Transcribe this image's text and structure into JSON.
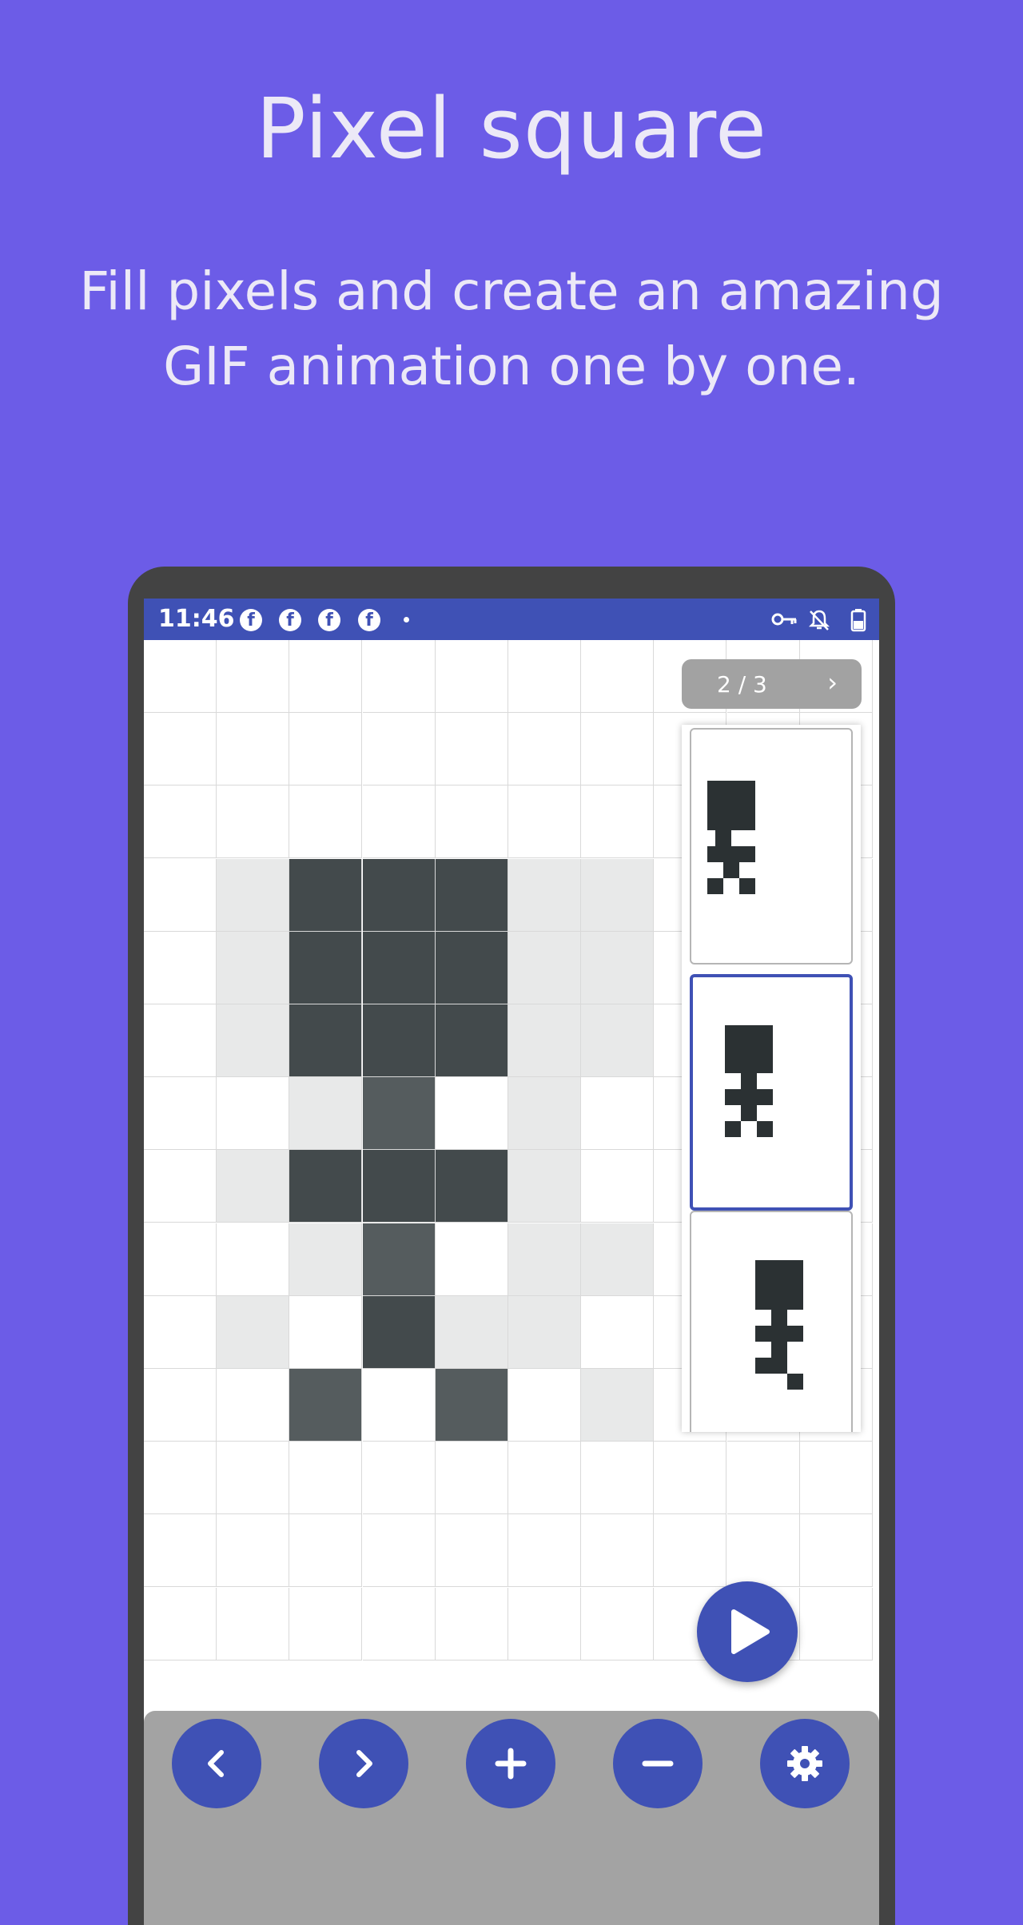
{
  "headline": "Pixel square",
  "subtitle": {
    "line1": "Fill pixels and create an amazing",
    "line2": "GIF animation one by one."
  },
  "status_bar": {
    "time": "11:46",
    "notification_icons": [
      "facebook-icon",
      "facebook-icon",
      "facebook-icon",
      "facebook-icon",
      "dot"
    ],
    "right_icons": [
      "vpn-key-icon",
      "notifications-off-icon",
      "battery-icon"
    ]
  },
  "frames": {
    "indicator": "2 / 3",
    "current": 2,
    "total": 3,
    "selected_index": 1
  },
  "canvas": {
    "colors": {
      "empty": "#ffffff",
      "light": "#e8e9e9",
      "dark": "#434a4c",
      "mid": "#555c5e",
      "grid_line": "#d9d9d9"
    },
    "columns": 10,
    "rows": 14,
    "cells": [
      "..........",
      "..........",
      "..........",
      ".LDDDLL...",
      ".LDDDLL...",
      ".LDDDLL...",
      "..LM.L....",
      ".LDDDL....",
      "..LM.LL...",
      ".L.DLL....",
      "..M.M.L...",
      "..........",
      "..........",
      ".........."
    ]
  },
  "accent_color": "#3f51b5",
  "background_color": "#6c5ce7",
  "toolbar": {
    "buttons": [
      "previous-frame",
      "next-frame",
      "add-frame",
      "remove-frame",
      "settings"
    ]
  }
}
